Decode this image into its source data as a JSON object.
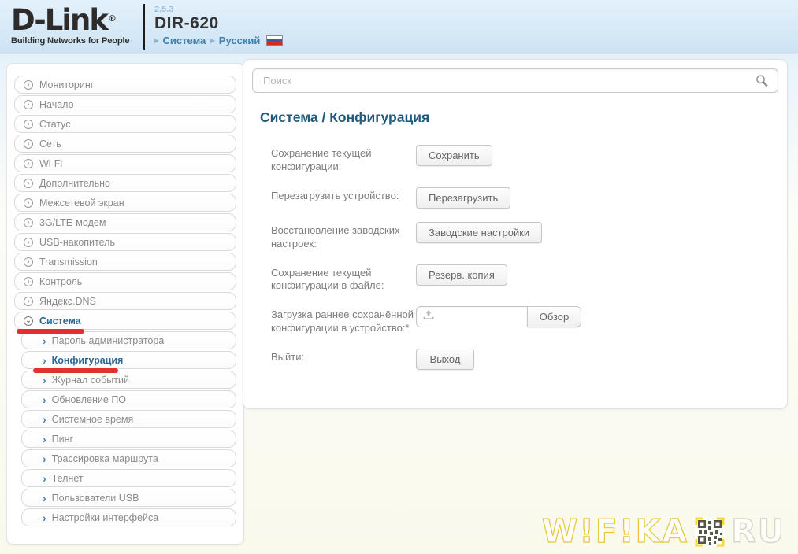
{
  "colors": {
    "header_bg": "#d3e7f6",
    "title_blue": "#1e5a7d",
    "active_item_blue": "#2a6792",
    "annotation_red": "#e23128",
    "watermark_yellow": "#f6d63c"
  },
  "header": {
    "logo_text": "D-Link",
    "logo_reg": "®",
    "logo_tagline": "Building Networks for People",
    "firmware_version": "2.5.3",
    "model": "DIR-620",
    "breadcrumb": [
      {
        "label": "Система"
      },
      {
        "label": "Русский"
      }
    ],
    "language_flag_icon": "russian-flag"
  },
  "sidebar": {
    "items": [
      {
        "label": "Мониторинг"
      },
      {
        "label": "Начало"
      },
      {
        "label": "Статус"
      },
      {
        "label": "Сеть"
      },
      {
        "label": "Wi-Fi"
      },
      {
        "label": "Дополнительно"
      },
      {
        "label": "Межсетевой экран"
      },
      {
        "label": "3G/LTE-модем"
      },
      {
        "label": "USB-накопитель"
      },
      {
        "label": "Transmission"
      },
      {
        "label": "Контроль"
      },
      {
        "label": "Яндекс.DNS"
      },
      {
        "label": "Система"
      },
      {
        "label": "Пароль администратора"
      },
      {
        "label": "Конфигурация"
      },
      {
        "label": "Журнал событий"
      },
      {
        "label": "Обновление ПО"
      },
      {
        "label": "Системное время"
      },
      {
        "label": "Пинг"
      },
      {
        "label": "Трассировка маршрута"
      },
      {
        "label": "Телнет"
      },
      {
        "label": "Пользователи USB"
      },
      {
        "label": "Настройки интерфейса"
      }
    ]
  },
  "main": {
    "search_placeholder": "Поиск",
    "search_icon": "magnifier",
    "page_title": "Система /  Конфигурация",
    "rows": [
      {
        "label": "Сохранение текущей конфигурации:",
        "button": "Сохранить"
      },
      {
        "label": "Перезагрузить устройство:",
        "button": "Перезагрузить"
      },
      {
        "label": "Восстановление заводских настроек:",
        "button": "Заводские настройки"
      },
      {
        "label": "Сохранение текущей конфигурации в файле:",
        "button": "Резерв. копия"
      },
      {
        "label": "Загрузка раннее сохранённой конфигурации в устройство:*",
        "file_icon": "upload",
        "browse_button": "Обзор"
      },
      {
        "label": "Выйти:",
        "button": "Выход"
      }
    ]
  },
  "watermark": {
    "left": "W!F!KA",
    "qr_icon": "qr-code",
    "right": "RU"
  }
}
